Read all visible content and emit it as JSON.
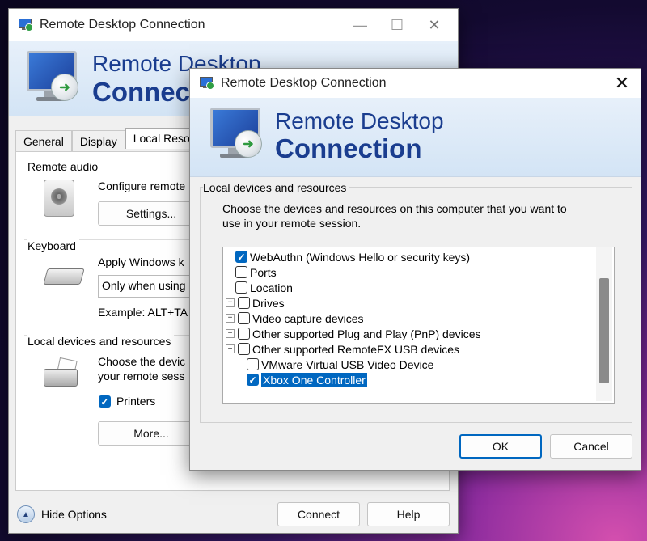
{
  "main_window": {
    "title": "Remote Desktop Connection",
    "banner_line1": "Remote Desktop",
    "banner_line2": "Connection",
    "tabs": [
      {
        "label": "General"
      },
      {
        "label": "Display"
      },
      {
        "label": "Local Reso"
      }
    ],
    "remote_audio": {
      "title": "Remote audio",
      "desc": "Configure remote",
      "settings_label": "Settings..."
    },
    "keyboard": {
      "title": "Keyboard",
      "desc": "Apply Windows k",
      "dropdown_value": "Only when using",
      "example": "Example: ALT+TA"
    },
    "local_devices": {
      "title": "Local devices and resources",
      "desc_line1": "Choose the devic",
      "desc_line2": "your remote sess",
      "printers_label": "Printers",
      "printers_checked": true,
      "more_label": "More..."
    },
    "hide_options_label": "Hide Options",
    "connect_label": "Connect",
    "help_label": "Help"
  },
  "dialog": {
    "title": "Remote Desktop Connection",
    "banner_line1": "Remote Desktop",
    "banner_line2": "Connection",
    "group_title": "Local devices and resources",
    "description_line1": "Choose the devices and resources on this computer that you want to",
    "description_line2": "use in your remote session.",
    "items": [
      {
        "label": "WebAuthn (Windows Hello or security keys)",
        "checked": true,
        "expander": "",
        "selected": false
      },
      {
        "label": "Ports",
        "checked": false,
        "expander": "",
        "selected": false
      },
      {
        "label": "Location",
        "checked": false,
        "expander": "",
        "selected": false
      },
      {
        "label": "Drives",
        "checked": false,
        "expander": "+",
        "selected": false
      },
      {
        "label": "Video capture devices",
        "checked": false,
        "expander": "+",
        "selected": false
      },
      {
        "label": "Other supported Plug and Play (PnP) devices",
        "checked": false,
        "expander": "+",
        "selected": false
      },
      {
        "label": "Other supported RemoteFX USB devices",
        "checked": false,
        "expander": "−",
        "selected": false
      },
      {
        "label": "VMware Virtual USB Video Device",
        "checked": false,
        "expander": "",
        "selected": false
      },
      {
        "label": "Xbox One Controller",
        "checked": true,
        "expander": "",
        "selected": true
      }
    ],
    "ok_label": "OK",
    "cancel_label": "Cancel"
  },
  "icons": {
    "check": "✓",
    "close": "✕",
    "minimize": "—",
    "maximize": "☐",
    "arrow": "➜",
    "chevron_up": "▲"
  }
}
